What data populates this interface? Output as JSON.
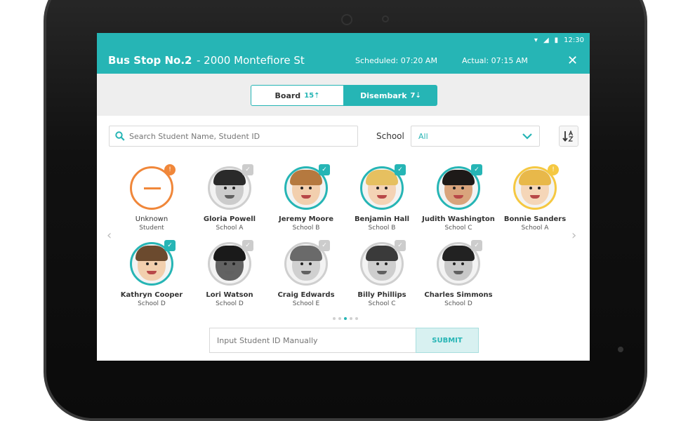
{
  "status": {
    "time": "12:30"
  },
  "header": {
    "stop_name": "Bus Stop No.2",
    "stop_address": "- 2000 Montefiore St",
    "scheduled": "Scheduled: 07:20 AM",
    "actual": "Actual: 07:15 AM",
    "close": "✕"
  },
  "toggle": {
    "board_label": "Board",
    "board_count": "15⇡",
    "disembark_label": "Disembark",
    "disembark_count": "7⇣"
  },
  "search": {
    "placeholder": "Search Student Name, Student ID"
  },
  "filter": {
    "school_label": "School",
    "school_value": "All"
  },
  "students": [
    {
      "name": "Unknown",
      "school": "Student"
    },
    {
      "name": "Gloria Powell",
      "school": "School A"
    },
    {
      "name": "Jeremy Moore",
      "school": "School B"
    },
    {
      "name": "Benjamin Hall",
      "school": "School B"
    },
    {
      "name": "Judith Washington",
      "school": "School C"
    },
    {
      "name": "Bonnie Sanders",
      "school": "School A"
    },
    {
      "name": "Kathryn Cooper",
      "school": "School D"
    },
    {
      "name": "Lori Watson",
      "school": "School D"
    },
    {
      "name": "Craig Edwards",
      "school": "School E"
    },
    {
      "name": "Billy Phillips",
      "school": "School C"
    },
    {
      "name": "Charles Simmons",
      "school": "School D"
    }
  ],
  "badges": {
    "alert": "!"
  },
  "manual": {
    "placeholder": "Input Student ID Manually",
    "submit_label": "SUBMIT"
  },
  "colors": {
    "accent": "#26b5b5",
    "alert": "#f0873a",
    "warning": "#f5c842"
  }
}
